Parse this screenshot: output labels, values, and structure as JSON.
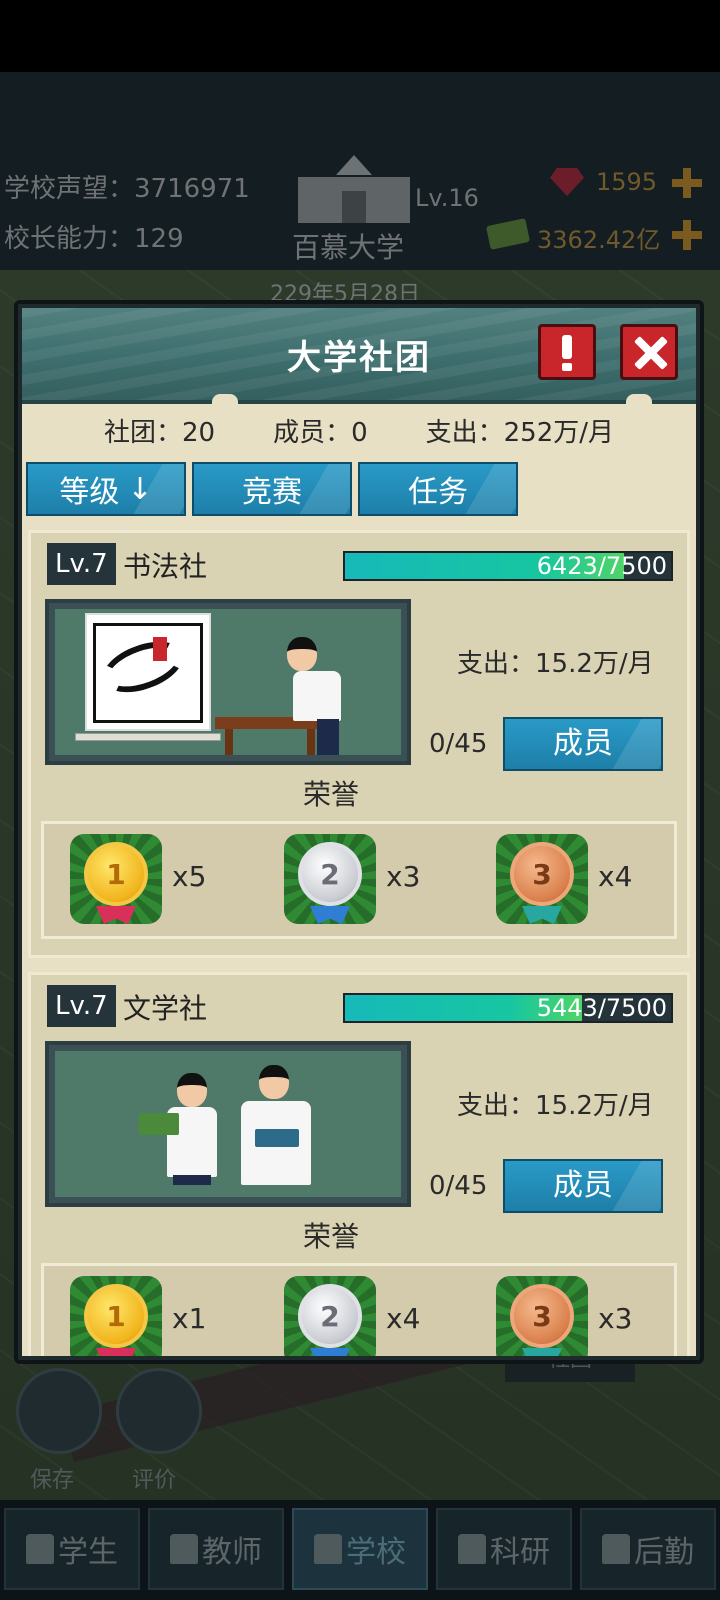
{
  "background": {
    "school_reputation": "学校声望：3716971",
    "principal_ability": "校长能力：129",
    "school_level": "Lv.16",
    "school_name": "百慕大学",
    "date": "229年5月28日",
    "gems": "1595",
    "money": "3362.42亿",
    "save_label": "保存",
    "rate_label": "评价",
    "club_tag": "社团"
  },
  "bottom_nav": {
    "tabs": [
      {
        "label": "学生"
      },
      {
        "label": "教师"
      },
      {
        "label": "学校",
        "active": true
      },
      {
        "label": "科研"
      },
      {
        "label": "后勤"
      }
    ]
  },
  "modal": {
    "title": "大学社团",
    "stats": {
      "clubs": "社团：20",
      "members": "成员：0",
      "expense": "支出：252万/月"
    },
    "filters": [
      {
        "label": "等级",
        "icon": "arrow-down-icon",
        "glyph": "↓"
      },
      {
        "label": "竞赛"
      },
      {
        "label": "任务"
      }
    ],
    "clubs": [
      {
        "level": "Lv.7",
        "name": "书法社",
        "xp_text": "6423/7500",
        "xp_progress": 0.856,
        "image": "calligraphy-club-image",
        "expense": "支出：15.2万/月",
        "member_count": "0/45",
        "members_label": "成员",
        "honor_label": "荣誉",
        "medals": [
          {
            "rank": "1",
            "count": "x5",
            "type": "gold"
          },
          {
            "rank": "2",
            "count": "x3",
            "type": "silver"
          },
          {
            "rank": "3",
            "count": "x4",
            "type": "bronze"
          }
        ]
      },
      {
        "level": "Lv.7",
        "name": "文学社",
        "xp_text": "5443/7500",
        "xp_progress": 0.726,
        "image": "literature-club-image",
        "expense": "支出：15.2万/月",
        "member_count": "0/45",
        "members_label": "成员",
        "honor_label": "荣誉",
        "medals": [
          {
            "rank": "1",
            "count": "x1",
            "type": "gold"
          },
          {
            "rank": "2",
            "count": "x4",
            "type": "silver"
          },
          {
            "rank": "3",
            "count": "x3",
            "type": "bronze"
          }
        ]
      }
    ]
  },
  "colors": {
    "accent_blue": "#1d7fa9",
    "header_teal": "#3f6f6f",
    "close_red": "#c8262a",
    "panel_cream": "#e7e0c4"
  }
}
